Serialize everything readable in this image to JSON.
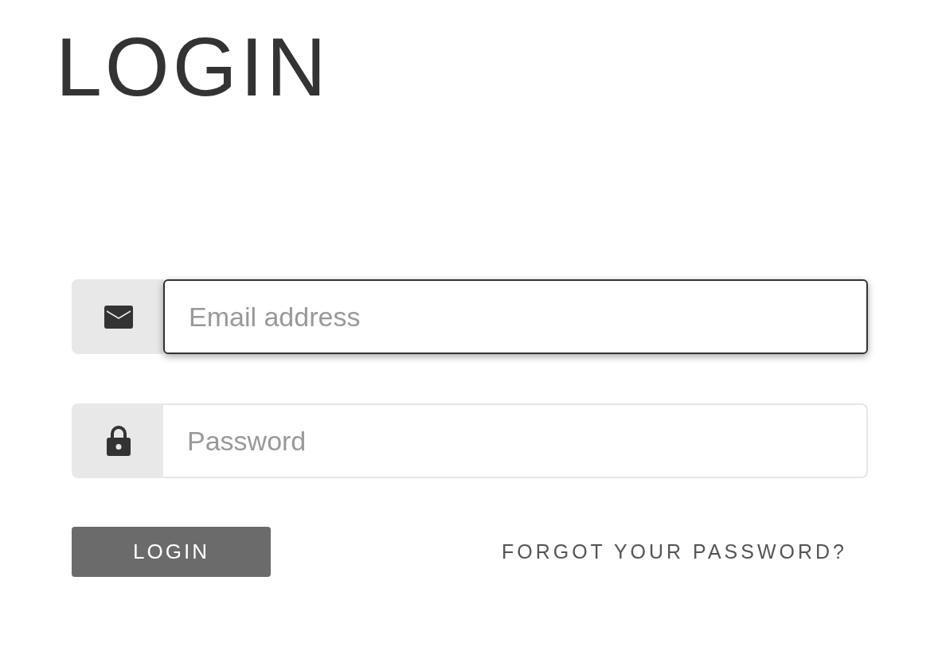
{
  "title": "LOGIN",
  "fields": [
    {
      "kind": "email",
      "placeholder": "Email address",
      "focused": true
    },
    {
      "kind": "password",
      "placeholder": "Password",
      "focused": false
    }
  ],
  "login_button": {
    "label": "LOGIN"
  },
  "forgot_link": {
    "label": "FORGOT YOUR PASSWORD?"
  }
}
